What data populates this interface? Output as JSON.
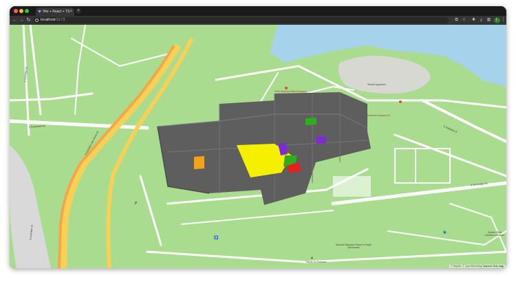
{
  "browser": {
    "tab_title": "Vite + React + TS",
    "close_glyph": "×",
    "newtab_glyph": "+",
    "url_host": "localhost",
    "url_port": ":5173",
    "back_glyph": "←",
    "forward_glyph": "→",
    "reload_glyph": "↻",
    "avatar_letter": "L",
    "colors": {
      "frame": "#1b1b1b",
      "toolbar": "#353535",
      "omnibox": "#282828"
    }
  },
  "map": {
    "attribution_prefix": "© Maptiler © OpenStreetMap",
    "attribution_link": "Improve this map",
    "street_labels": {
      "e_roosevelt": "E Roosevelt Rd",
      "lake_shore": "S DuSable Lake Shore Dr",
      "columbus": "S Columbus Dr",
      "solidarity": "E Solidarity Dr",
      "mcfetridge": "E McFetridge Dr",
      "museum_campus": "Museum Campus Dr",
      "columbus_lower": "S Columbus Dr"
    },
    "poi_labels": {
      "shedd": "Shedd Aquarium",
      "museum_campus": "Museum Campus",
      "tribute": "Tribute to Freedom",
      "olympics": "Special Olympics Flame of Hope Monument",
      "soldier_field": "Soldier Field Children's Garden",
      "field_museum_entrance": "Field Museum West Entrance"
    },
    "floor_colors": {
      "shell": "#5e5e5e",
      "yellow_room": "#f4f000",
      "orange_room": "#f3a21c",
      "green_room": "#2eae1e",
      "purple_room": "#7d2bd6",
      "red_room": "#e8201d",
      "water": "#a6d2ec",
      "road_major": "#f3a64a",
      "road_highway": "#f7d155"
    },
    "icons": [
      "parking-icon",
      "accessible-icon",
      "monument-icon",
      "bus-stop-icon"
    ]
  }
}
